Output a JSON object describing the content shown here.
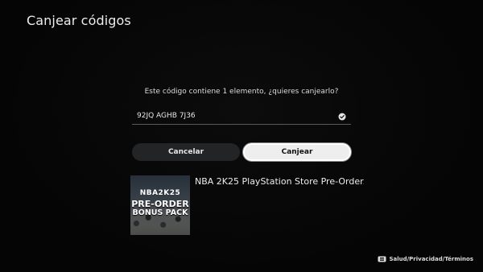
{
  "header": {
    "title": "Canjear códigos"
  },
  "dialog": {
    "prompt": "Este código contiene 1 elemento, ¿quieres canjearlo?",
    "code_value": "92JQ AGHB 7J36",
    "cancel_label": "Cancelar",
    "redeem_label": "Canjear"
  },
  "product": {
    "name": "NBA 2K25 PlayStation Store Pre-Order...",
    "thumb_logo": "NBA2K25",
    "thumb_line1": "PRE-ORDER",
    "thumb_line2": "BONUS PACK"
  },
  "footer": {
    "icon": "options-button-icon",
    "label": "Salud/Privacidad/Términos"
  },
  "colors": {
    "background": "#050505",
    "button_dark": "#222426",
    "button_light": "#eeeeee"
  }
}
